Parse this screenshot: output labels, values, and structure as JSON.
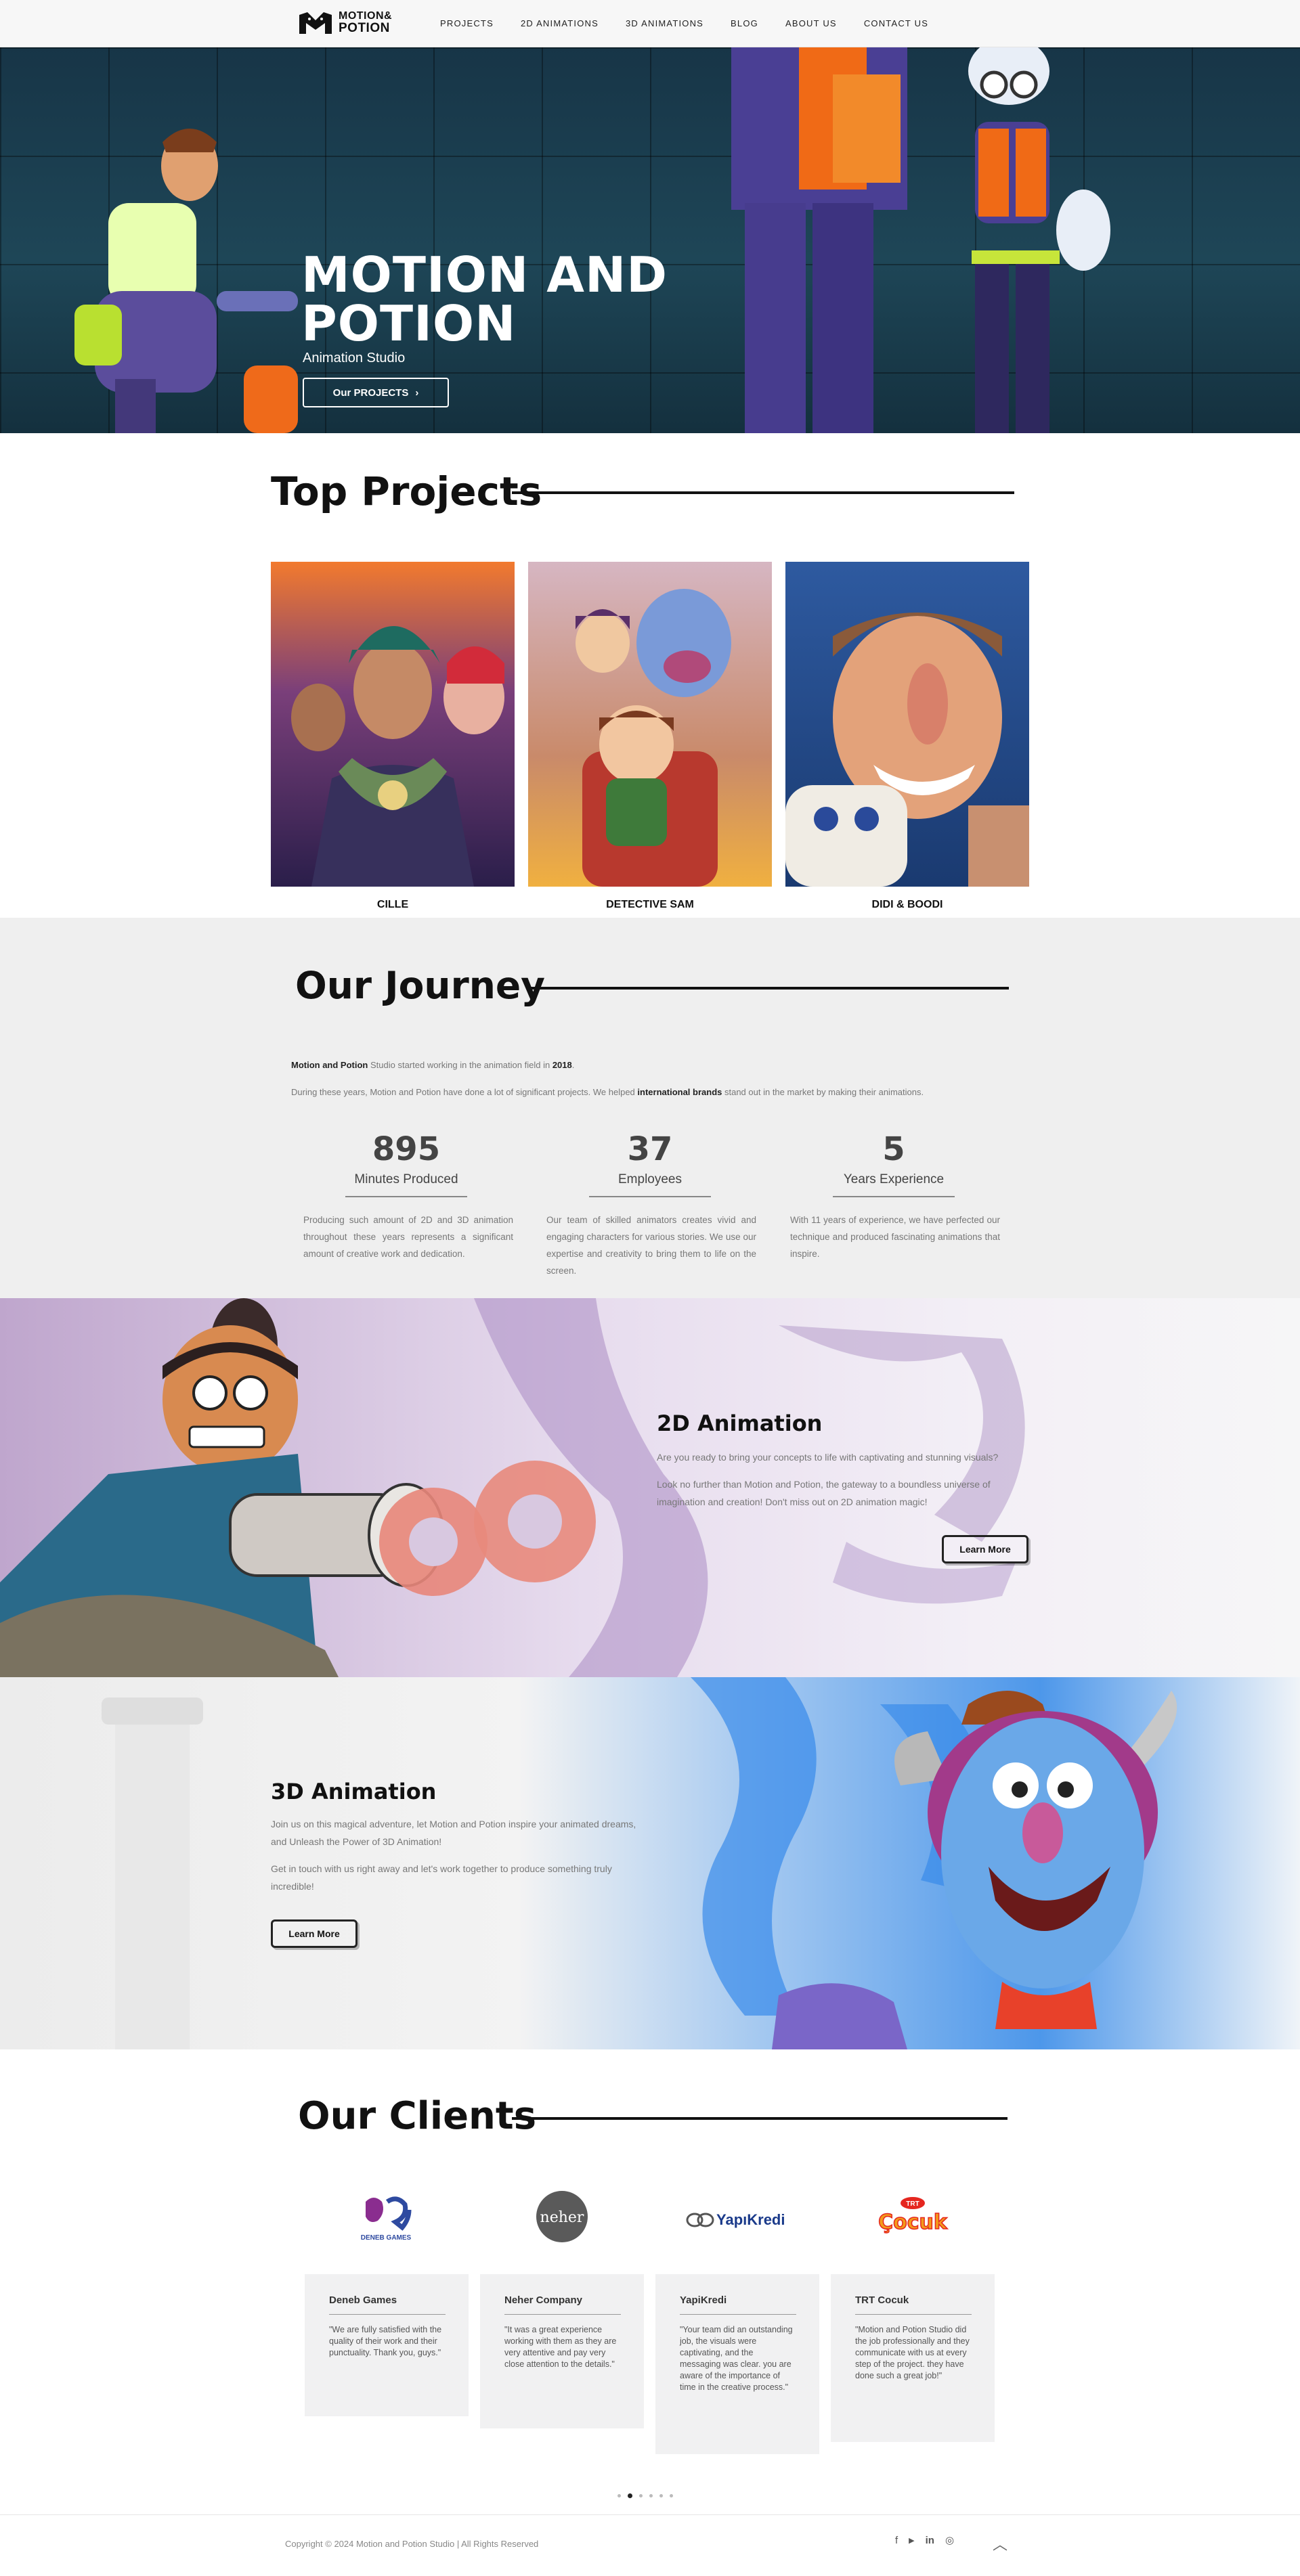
{
  "nav": {
    "logo_text_1": "MOTION&",
    "logo_text_2": "POTION",
    "items": [
      "PROJECTS",
      "2D ANIMATIONS",
      "3D ANIMATIONS",
      "BLOG",
      "ABOUT US",
      "CONTACT US"
    ]
  },
  "hero": {
    "title_line1": "MOTION AND",
    "title_line2": "POTION",
    "subtitle": "Animation Studio",
    "button_label": "Our PROJECTS",
    "button_icon": "chevron-right-icon"
  },
  "top_projects": {
    "title": "Top Projects",
    "items": [
      {
        "name": "CILLE"
      },
      {
        "name": "DETECTIVE SAM"
      },
      {
        "name": "DIDI & BOODI"
      }
    ]
  },
  "journey": {
    "title": "Our Journey",
    "line1_bold": "Motion and Potion",
    "line1_text": " Studio started working in the animation field in ",
    "line1_year": "2018",
    "line1_end": ".",
    "line2_text": "During these years, Motion and Potion have done a lot of significant projects. We helped ",
    "line2_bold": "international brands",
    "line2_end": " stand out in the market by making their animations.",
    "stats": [
      {
        "number": "895",
        "label": "Minutes Produced",
        "desc": "Producing such amount of 2D and 3D animation throughout these years represents a significant amount of creative work and dedication."
      },
      {
        "number": "37",
        "label": "Employees",
        "desc": "Our team of skilled animators creates vivid and engaging characters for various stories. We use our expertise and creativity to bring them to life on the screen."
      },
      {
        "number": "5",
        "label": "Years Experience",
        "desc": "With 11 years of experience, we have perfected our technique and produced fascinating animations that inspire."
      }
    ]
  },
  "anim2d": {
    "title": "2D Animation",
    "p1": "Are you ready to bring your concepts to life with captivating and stunning visuals?",
    "p2": "Look no further than Motion and Potion, the gateway to a boundless universe of imagination and creation! Don't miss out on 2D animation magic!",
    "button": "Learn More"
  },
  "anim3d": {
    "title": "3D Animation",
    "p1": "Join us on this magical adventure, let Motion and Potion inspire your animated dreams, and Unleash the Power of 3D Animation!",
    "p2": "Get in touch with us right away and let's work together to produce something truly incredible!",
    "button": "Learn More"
  },
  "clients": {
    "title": "Our Clients",
    "logos": [
      "Deneb Games",
      "neher",
      "YapıKredi",
      "Çocuk"
    ],
    "logo_texts": {
      "deneb": "DENEB GAMES",
      "neher": "neher",
      "yapi": "YapıKredi",
      "trt": "TRT",
      "cocuk": "Çocuk"
    },
    "cards": [
      {
        "name": "Deneb Games",
        "quote": "\"We are fully satisfied with the quality of their work and their punctuality. Thank you, guys.\""
      },
      {
        "name": "Neher Company",
        "quote": "\"It was a great experience working with them as they are very attentive and pay very close attention to the details.\""
      },
      {
        "name": "YapiKredi",
        "quote": "\"Your team did an outstanding job, the visuals were captivating, and the messaging was clear. you are aware of the importance of time in the creative process.\""
      },
      {
        "name": "TRT Cocuk",
        "quote": "\"Motion and Potion Studio did the job professionally and they communicate with us at every step of the project. they have done such a great job!\""
      }
    ],
    "carousel_pages": 6,
    "carousel_active": 2
  },
  "footer": {
    "copyright": "Copyright © 2024 Motion and Potion Studio | All Rights Reserved",
    "social": [
      "f",
      "▶",
      "in",
      "◎"
    ],
    "social_icons": [
      "facebook-icon",
      "youtube-icon",
      "linkedin-icon",
      "instagram-icon"
    ],
    "to_top": "︿"
  },
  "colors": {
    "hero_bg": "#1e4657",
    "journey_bg": "#efefef",
    "card_bg": "#f1f1f2",
    "orange": "#f06a16",
    "purple": "#5a4fa8"
  }
}
